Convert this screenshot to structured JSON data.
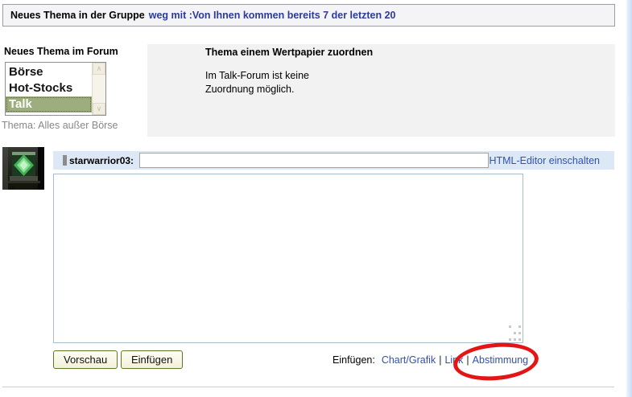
{
  "header": {
    "title": "Neues Thema in der Gruppe",
    "group_link": "weg mit :Von Ihnen kommen bereits 7 der letzten 20"
  },
  "forum_picker": {
    "heading": "Neues Thema im Forum",
    "items": [
      {
        "label": "Börse",
        "selected": false
      },
      {
        "label": "Hot-Stocks",
        "selected": false
      },
      {
        "label": "Talk",
        "selected": true
      }
    ],
    "selected_item": "Talk",
    "topic_label": "Thema: Alles außer Börse"
  },
  "wertpapier": {
    "heading": "Thema einem Wertpapier zuordnen",
    "note": [
      "Im Talk-Forum ist keine",
      "Zuordnung möglich."
    ]
  },
  "composer": {
    "username": "starwarrior03:",
    "title_input_value": "",
    "html_editor_link": "HTML-Editor einschalten",
    "body_value": "",
    "buttons": {
      "preview": "Vorschau",
      "submit": "Einfügen"
    },
    "insert": {
      "label": "Einfügen:",
      "links": [
        "Chart/Grafik",
        "Link",
        "Abstimmung"
      ],
      "separator": "|",
      "highlighted_link": "Abstimmung"
    }
  },
  "icons": {
    "scrollbar_up": "∧",
    "scrollbar_down": "∨"
  },
  "annotation": {
    "shape": "ellipse",
    "color": "#e51515",
    "target": "Abstimmung"
  },
  "colors": {
    "header_link_navy": "#2b3a9e",
    "link_blue": "#2d50b8",
    "selected_item_bg": "#9dad7e",
    "title_row_bg": "#dde8f6",
    "panel_bg": "#f2f2f2",
    "annotation_red": "#e51515"
  }
}
